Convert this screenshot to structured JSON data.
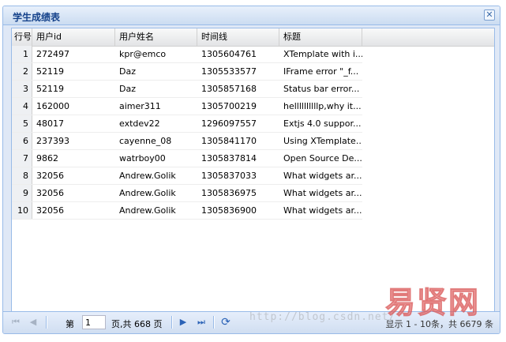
{
  "panel": {
    "title": "学生成绩表",
    "close_icon": "close-icon"
  },
  "grid": {
    "columns": [
      "行号",
      "用户id",
      "用户姓名",
      "时间线",
      "标题"
    ],
    "rows": [
      {
        "n": "1",
        "id": "272497",
        "name": "kpr@emco",
        "time": "1305604761",
        "title": "XTemplate with i..."
      },
      {
        "n": "2",
        "id": "52119",
        "name": "Daz",
        "time": "1305533577",
        "title": "IFrame error \"_f..."
      },
      {
        "n": "3",
        "id": "52119",
        "name": "Daz",
        "time": "1305857168",
        "title": "Status bar error..."
      },
      {
        "n": "4",
        "id": "162000",
        "name": "aimer311",
        "time": "1305700219",
        "title": "hellllllllllp,why it..."
      },
      {
        "n": "5",
        "id": "48017",
        "name": "extdev22",
        "time": "1296097557",
        "title": "Extjs 4.0 suppor..."
      },
      {
        "n": "6",
        "id": "237393",
        "name": "cayenne_08",
        "time": "1305841170",
        "title": "Using XTemplate..."
      },
      {
        "n": "7",
        "id": "9862",
        "name": "watrboy00",
        "time": "1305837814",
        "title": "Open Source De..."
      },
      {
        "n": "8",
        "id": "32056",
        "name": "Andrew.Golik",
        "time": "1305837033",
        "title": "What widgets ar..."
      },
      {
        "n": "9",
        "id": "32056",
        "name": "Andrew.Golik",
        "time": "1305836975",
        "title": "What widgets ar..."
      },
      {
        "n": "10",
        "id": "32056",
        "name": "Andrew.Golik",
        "time": "1305836900",
        "title": "What widgets ar..."
      }
    ]
  },
  "paging": {
    "page_label": "第",
    "page_value": "1",
    "page_of": "页,共 668 页",
    "display_info": "显示 1 - 10条，共 6679 条",
    "icons": [
      "first-page-icon",
      "prev-page-icon",
      "next-page-icon",
      "last-page-icon",
      "refresh-icon"
    ]
  },
  "watermark": {
    "text": "http://blog.csdn.net/",
    "logo_text": "易贤网",
    "logo_sub": "www.ynpxrz.com"
  }
}
